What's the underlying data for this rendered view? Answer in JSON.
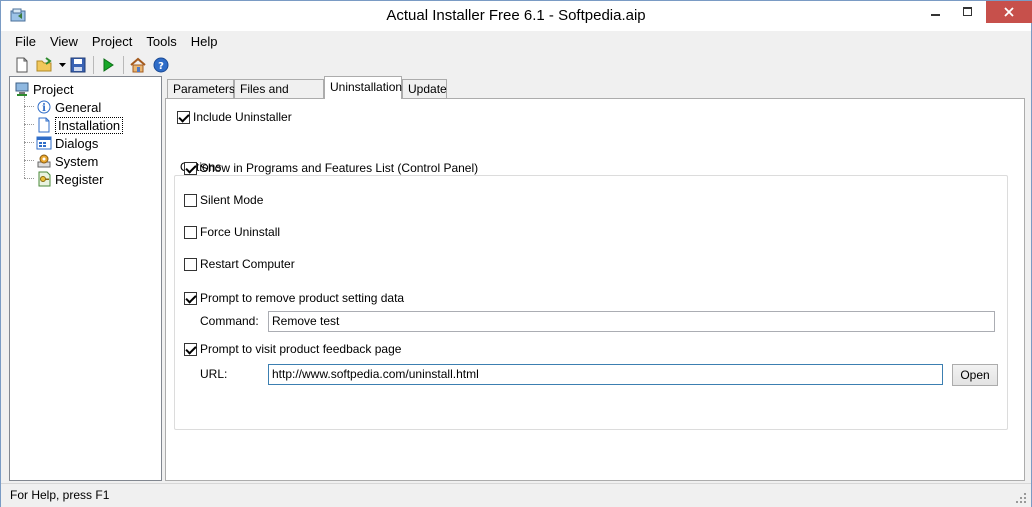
{
  "window": {
    "title": "Actual Installer Free 6.1 - Softpedia.aip"
  },
  "menu": [
    "File",
    "View",
    "Project",
    "Tools",
    "Help"
  ],
  "toolbar": [
    "new-icon",
    "open-folder-icon",
    "dropdown-arrow-icon",
    "save-icon",
    "run-icon",
    "home-icon",
    "help-icon"
  ],
  "tree": {
    "root": "Project",
    "items": [
      "General",
      "Installation",
      "Dialogs",
      "System",
      "Register"
    ],
    "selected": "Installation"
  },
  "tabs": [
    "Parameters",
    "Files and Folders",
    "Uninstallation",
    "Update"
  ],
  "active_tab": "Uninstallation",
  "uninstall": {
    "include_uninstaller": {
      "label": "Include Uninstaller",
      "checked": true
    },
    "options_title": "Options",
    "show_in_programs": {
      "label": "Show in Programs and Features List (Control Panel)",
      "checked": true
    },
    "silent_mode": {
      "label": "Silent Mode",
      "checked": false
    },
    "force_uninstall": {
      "label": "Force Uninstall",
      "checked": false
    },
    "restart_computer": {
      "label": "Restart Computer",
      "checked": false
    },
    "prompt_remove": {
      "label": "Prompt to remove product setting data",
      "checked": true
    },
    "command_label": "Command:",
    "command_value": "Remove test",
    "prompt_feedback": {
      "label": "Prompt to visit product feedback page",
      "checked": true
    },
    "url_label": "URL:",
    "url_value": "http://www.softpedia.com/uninstall.html",
    "open_button": "Open"
  },
  "status": {
    "text": "For Help, press F1"
  },
  "colors": {
    "close_button": "#c7504b",
    "window_border": "#7a9bc4",
    "run_green": "#18a828"
  }
}
